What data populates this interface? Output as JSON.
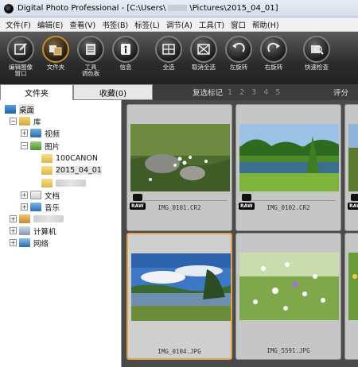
{
  "window": {
    "title": "Digital Photo Professional - [C:\\Users\\",
    "title_path": "\\Pictures\\2015_04_01]"
  },
  "menu": [
    "文件(F)",
    "编辑(E)",
    "查看(V)",
    "书签(B)",
    "标签(L)",
    "调节(A)",
    "工具(T)",
    "窗口",
    "帮助(H)"
  ],
  "toolbar": [
    {
      "label": "编辑图像\n窗口",
      "icon": "edit-image-window-icon"
    },
    {
      "label": "文件夹",
      "icon": "folder-icon",
      "active": true
    },
    {
      "label": "工具\n调色板",
      "icon": "tool-palette-icon"
    },
    {
      "label": "信息",
      "icon": "info-icon"
    },
    {
      "label": "全选",
      "icon": "select-all-icon"
    },
    {
      "label": "取消全选",
      "icon": "clear-all-icon"
    },
    {
      "label": "左旋转",
      "icon": "rotate-left-icon"
    },
    {
      "label": "右旋转",
      "icon": "rotate-right-icon"
    },
    {
      "label": "快速检查",
      "icon": "quick-check-icon"
    }
  ],
  "tabs": {
    "folder": "文件夹",
    "bookmark": "收藏(0)"
  },
  "filter": {
    "checkmark_label": "复选标记",
    "checkmarks": "1 2 3 4 5",
    "rating_label": "评分"
  },
  "tree": {
    "desktop": "桌面",
    "library": "库",
    "video": "视频",
    "pictures": "图片",
    "folder_canon": "100CANON",
    "folder_date": "2015_04_01",
    "documents": "文档",
    "music": "音乐",
    "computer": "计算机",
    "network": "网络"
  },
  "thumbnails": [
    {
      "filename": "IMG_0101.CR2",
      "raw": "RAW"
    },
    {
      "filename": "IMG_0102.CR2",
      "raw": "RAW"
    },
    {
      "filename": "",
      "raw": "RAW"
    },
    {
      "filename": "IMG_0104.JPG"
    },
    {
      "filename": "IMG_5591.JPG"
    }
  ],
  "colors": {
    "toolbar_bg": "#2c2c2c",
    "selection_border": "#e0a24a",
    "grid_bg": "#4a4a4a"
  }
}
